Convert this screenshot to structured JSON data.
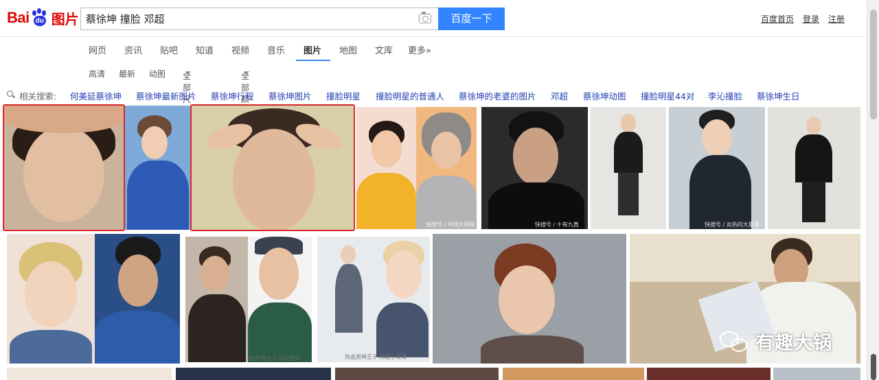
{
  "logo": {
    "brand_text": "Bai",
    "paw_text": "du",
    "product": "图片"
  },
  "search": {
    "query": "蔡徐坤 撞脸 邓超",
    "button_label": "百度一下",
    "camera_icon": "camera-icon"
  },
  "toplinks": [
    "百度首页",
    "登录",
    "注册"
  ],
  "nav": {
    "tabs": [
      "网页",
      "资讯",
      "贴吧",
      "知道",
      "视频",
      "音乐",
      "图片",
      "地图",
      "文库",
      "更多»"
    ],
    "active": "图片",
    "accent": "#3388ff"
  },
  "filters": [
    "高清",
    "最新",
    "动图",
    "全部尺寸",
    "全部颜色"
  ],
  "related": {
    "label": "相关搜索:",
    "items": [
      "何美延蔡徐坤",
      "蔡徐坤最新图片",
      "蔡徐坤行程",
      "蔡徐坤图片",
      "撞脸明星",
      "撞脸明星的普通人",
      "蔡徐坤的老婆的图片",
      "邓超",
      "蔡徐坤动图",
      "撞脸明星44对",
      "李沁撞脸",
      "蔡徐坤生日"
    ]
  },
  "images": {
    "captions": [
      "快搜号 / 十有九真",
      "快搜号 / 炎热的大夏季",
      "热血男神主子·邓超变帅",
      "热血男神王子·邓超小哥哥"
    ]
  },
  "highlight_color": "#d9272b",
  "watermark": {
    "text": "有趣大锅",
    "icon": "wechat-icon"
  }
}
